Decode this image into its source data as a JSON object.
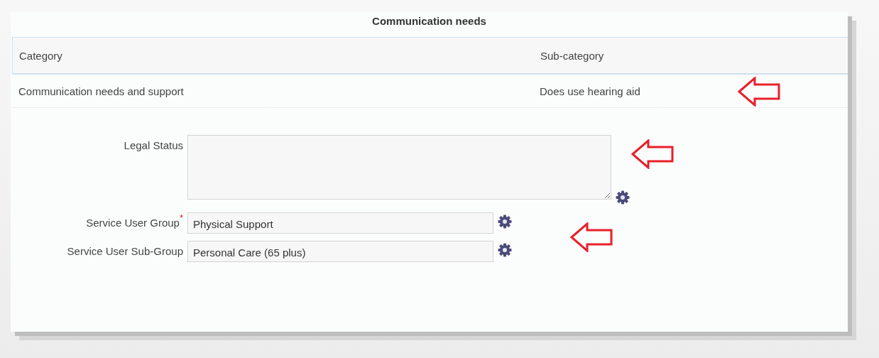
{
  "panel": {
    "title": "Communication needs"
  },
  "table": {
    "columns": [
      "Category",
      "Sub-category"
    ],
    "rows": [
      [
        "Communication needs and support",
        "Does use hearing aid"
      ]
    ]
  },
  "form": {
    "fields": [
      {
        "kind": "textarea",
        "label": "Legal Status"
      },
      {
        "kind": "input",
        "label": "Service User Group",
        "required_mark": "*",
        "value": "Physical Support"
      },
      {
        "kind": "input",
        "label": "Service User Sub-Group",
        "value": "Personal Care (65 plus)"
      }
    ]
  }
}
